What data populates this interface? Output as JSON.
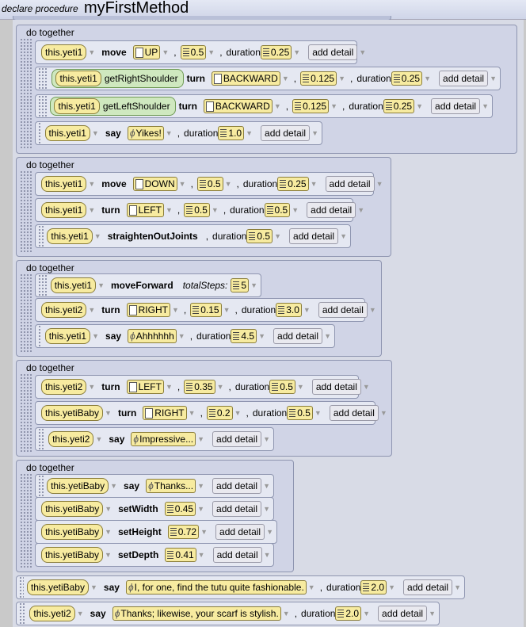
{
  "header": {
    "keyword": "declare procedure",
    "method_name": "myFirstMethod"
  },
  "ui": {
    "do_together": "do together",
    "add_detail": "add detail",
    "dropdown": "▼",
    "duration": "duration",
    "comma": ",",
    "total_steps": "totalSteps:"
  },
  "blocks": [
    {
      "rows": [
        {
          "obj": "this.yeti1",
          "verb": "move",
          "p1": "UP",
          "p2": "0.5",
          "dur": "0.25"
        },
        {
          "obj": "this.yeti1",
          "getter": "getRightShoulder",
          "verb": "turn",
          "p1": "BACKWARD",
          "p2": "0.125",
          "dur": "0.25"
        },
        {
          "obj": "this.yeti1",
          "getter": "getLeftShoulder",
          "verb": "turn",
          "p1": "BACKWARD",
          "p2": "0.125",
          "dur": "0.25"
        },
        {
          "obj": "this.yeti1",
          "verb": "say",
          "text": "Yikes!",
          "dur": "1.0"
        }
      ]
    },
    {
      "rows": [
        {
          "obj": "this.yeti1",
          "verb": "move",
          "p1": "DOWN",
          "p2": "0.5",
          "dur": "0.25"
        },
        {
          "obj": "this.yeti1",
          "verb": "turn",
          "p1": "LEFT",
          "p2": "0.5",
          "dur": "0.5"
        },
        {
          "obj": "this.yeti1",
          "verb": "straightenOutJoints",
          "dur": "0.5"
        }
      ]
    },
    {
      "rows": [
        {
          "obj": "this.yeti1",
          "verb": "moveForward",
          "steps": "5"
        },
        {
          "obj": "this.yeti2",
          "verb": "turn",
          "p1": "RIGHT",
          "p2": "0.15",
          "dur": "3.0"
        },
        {
          "obj": "this.yeti1",
          "verb": "say",
          "text": "Ahhhhhh",
          "dur": "4.5"
        }
      ]
    },
    {
      "rows": [
        {
          "obj": "this.yeti2",
          "verb": "turn",
          "p1": "LEFT",
          "p2": "0.35",
          "dur": "0.5"
        },
        {
          "obj": "this.yetiBaby",
          "verb": "turn",
          "p1": "RIGHT",
          "p2": "0.2",
          "dur": "0.5"
        },
        {
          "obj": "this.yeti2",
          "verb": "say",
          "text": "Impressive..."
        }
      ]
    },
    {
      "rows": [
        {
          "obj": "this.yetiBaby",
          "verb": "say",
          "text": "Thanks..."
        },
        {
          "obj": "this.yetiBaby",
          "verb": "setWidth",
          "num": "0.45"
        },
        {
          "obj": "this.yetiBaby",
          "verb": "setHeight",
          "num": "0.72"
        },
        {
          "obj": "this.yetiBaby",
          "verb": "setDepth",
          "num": "0.41"
        }
      ]
    }
  ],
  "loose": [
    {
      "obj": "this.yetiBaby",
      "verb": "say",
      "text": "I, for one, find the tutu quite fashionable.",
      "dur": "2.0"
    },
    {
      "obj": "this.yeti2",
      "verb": "say",
      "text": "Thanks; likewise, your scarf is stylish.",
      "dur": "2.0"
    }
  ]
}
